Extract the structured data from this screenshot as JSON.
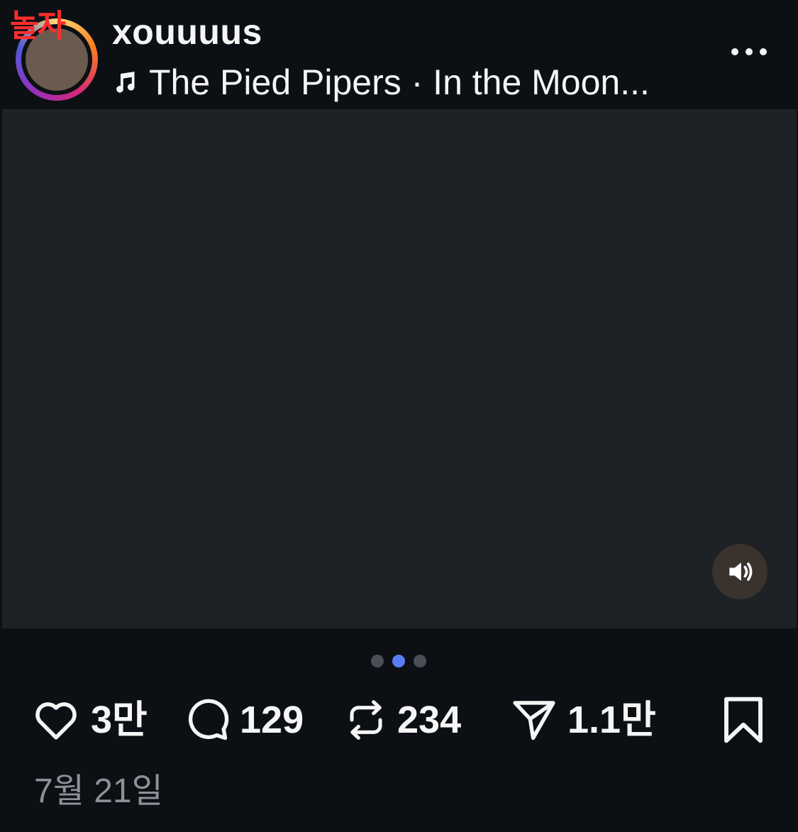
{
  "post": {
    "watermark": "놀자",
    "username": "xouuuus",
    "music": "The Pied Pipers · In the Moon...",
    "photo_label": "Post photo",
    "carousel": {
      "count": 3,
      "active_index": 1
    },
    "actions": {
      "likes": "3만",
      "comments": "129",
      "reposts": "234",
      "shares": "1.1만"
    },
    "date": "7월 21일",
    "icons": [
      "heart-icon",
      "comment-icon",
      "repost-icon",
      "send-icon",
      "bookmark-icon",
      "music-note-icon",
      "more-icon",
      "speaker-icon"
    ]
  },
  "colors": {
    "background": "#0c1014",
    "text": "#f5f5f5",
    "muted_text": "#8e9197",
    "active_dot": "#5b7cf3",
    "inactive_dot": "#4a4f57"
  }
}
